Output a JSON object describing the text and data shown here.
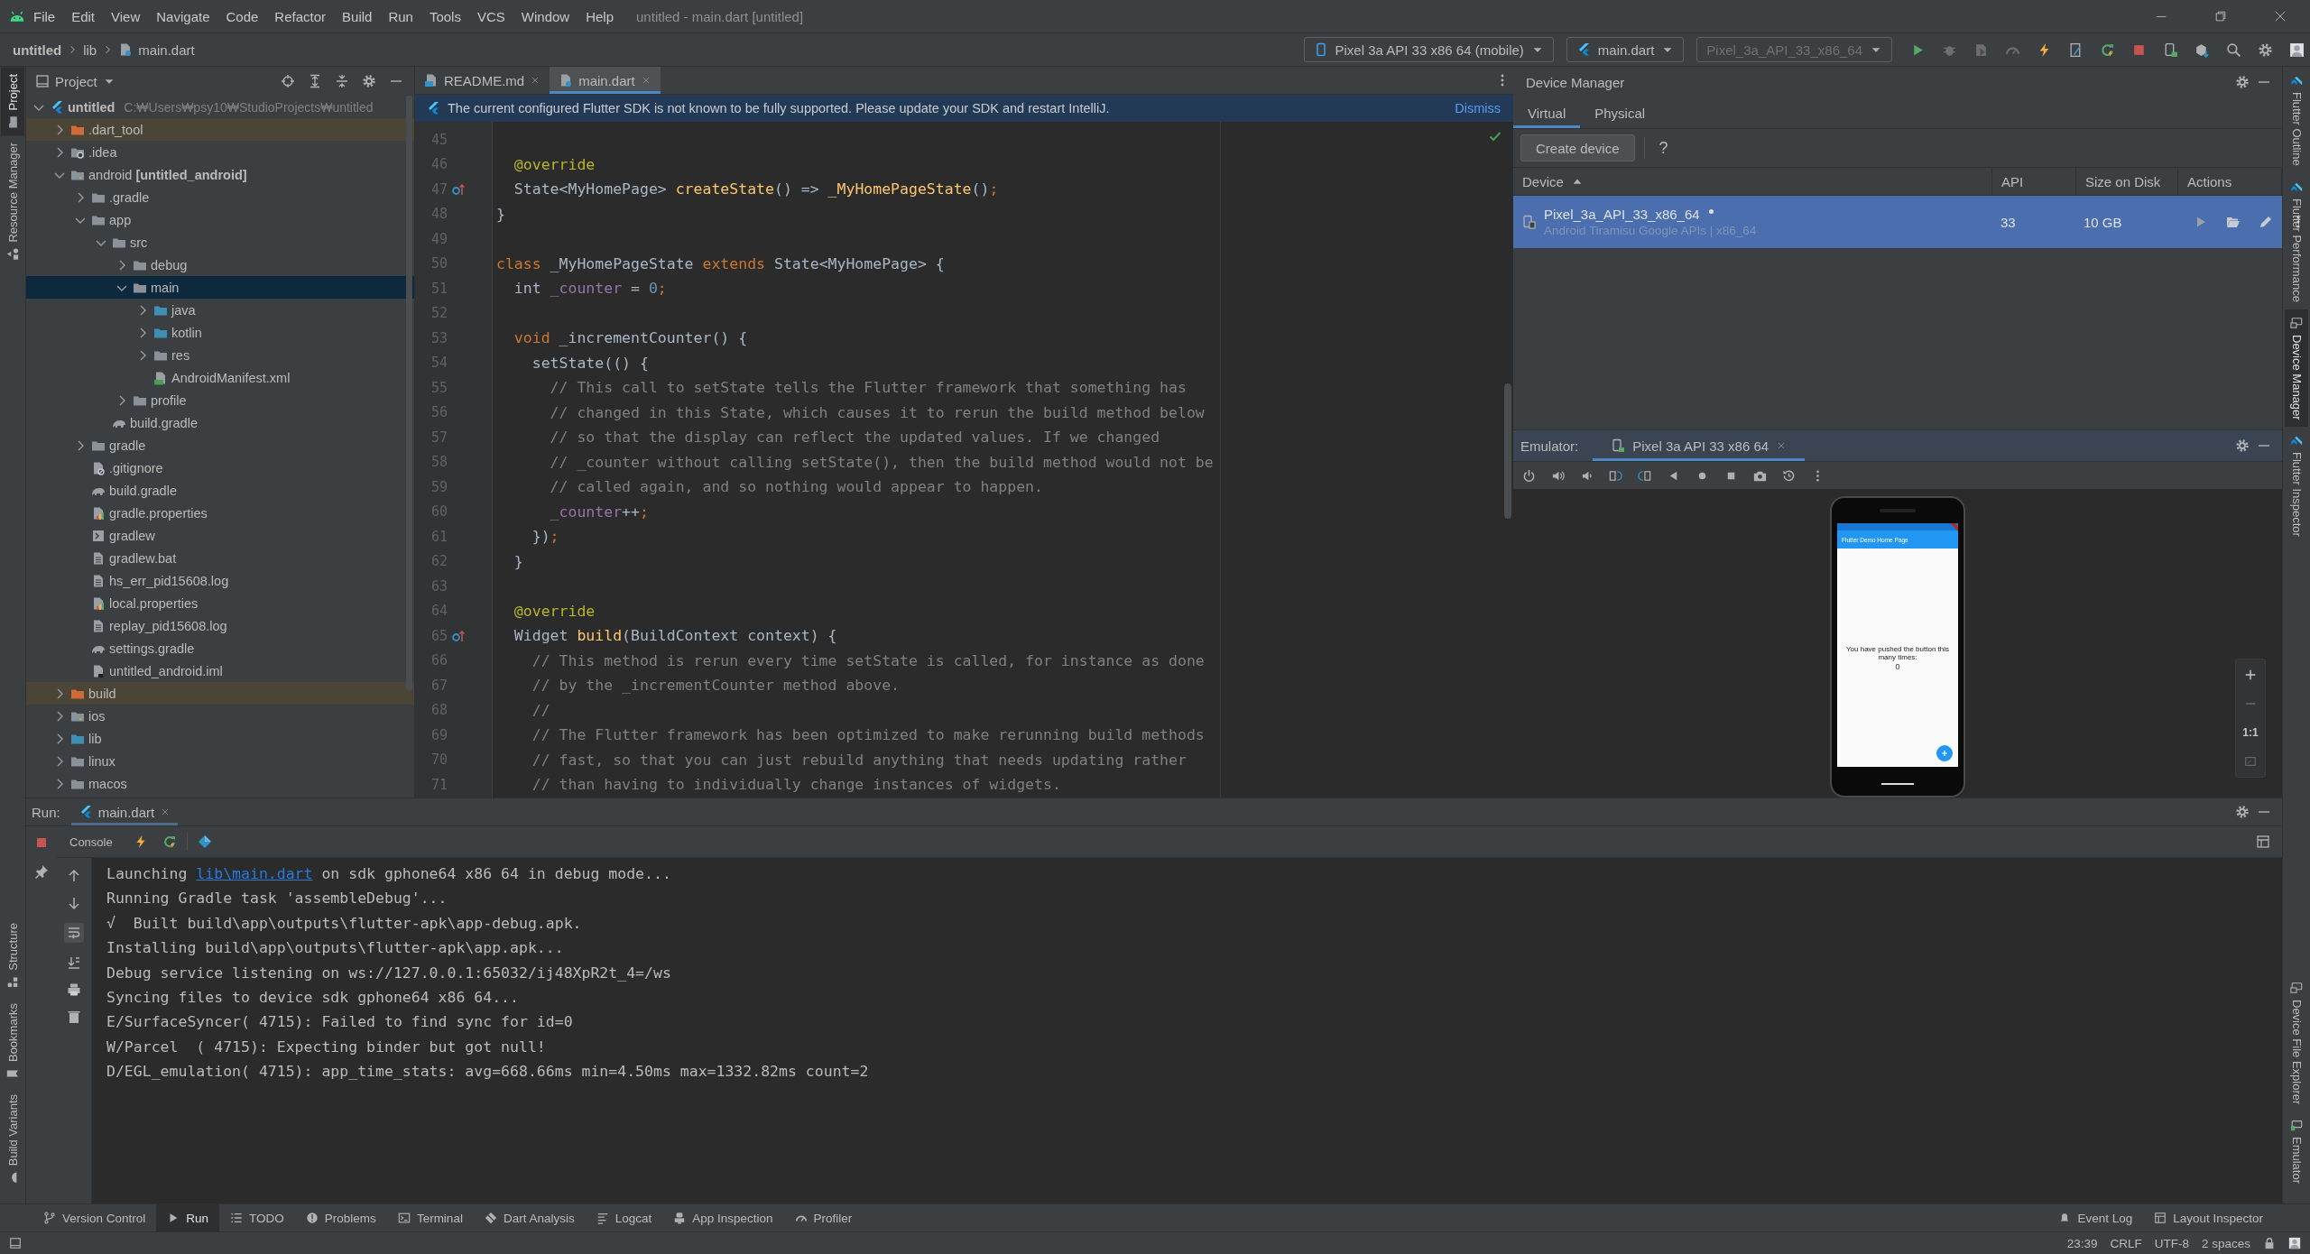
{
  "menu_bar": {
    "items": [
      "File",
      "Edit",
      "View",
      "Navigate",
      "Code",
      "Refactor",
      "Build",
      "Run",
      "Tools",
      "VCS",
      "Window",
      "Help"
    ],
    "title": "untitled - main.dart [untitled]"
  },
  "breadcrumbs": [
    {
      "label": "untitled",
      "kind": "project"
    },
    {
      "label": "lib",
      "kind": "folder"
    },
    {
      "label": "main.dart",
      "kind": "dart"
    }
  ],
  "run_toolbar": {
    "device_selector": "Pixel 3a API 33 x86 64 (mobile)",
    "config_selector": "main.dart",
    "target_selector": {
      "label": "Pixel_3a_API_33_x86_64",
      "disabled": true
    }
  },
  "left_strip": {
    "top": [
      {
        "label": "Project",
        "selected": true
      },
      {
        "label": "Resource Manager",
        "selected": false
      }
    ],
    "bottom": [
      {
        "label": "Structure",
        "selected": false
      },
      {
        "label": "Bookmarks",
        "selected": false
      },
      {
        "label": "Build Variants",
        "selected": false
      }
    ]
  },
  "right_strip": {
    "top": [
      {
        "label": "Flutter Outline",
        "selected": false
      },
      {
        "label": "Flutter Performance",
        "selected": false
      },
      {
        "label": "Device Manager",
        "selected": true
      },
      {
        "label": "Flutter Inspector",
        "selected": false
      }
    ],
    "bottom": [
      {
        "label": "Device File Explorer",
        "selected": false
      },
      {
        "label": "Emulator",
        "selected": false
      }
    ]
  },
  "project_panel": {
    "title": "Project",
    "tree": [
      {
        "label": "untitled",
        "kind": "project",
        "path": "C:₩Users₩psy10₩StudioProjects₩untitled",
        "selected": false,
        "children": [
          {
            "label": ".dart_tool",
            "kind": "excluded",
            "selected": false
          },
          {
            "label": ".idea",
            "kind": "idea",
            "selected": false
          },
          {
            "label": "android **[untitled_android]**",
            "kind": "module",
            "selected": false,
            "children": [
              {
                "label": ".gradle",
                "kind": "folder",
                "selected": false
              },
              {
                "label": "app",
                "kind": "folder",
                "selected": false,
                "children": [
                  {
                    "label": "src",
                    "kind": "folder",
                    "selected": false,
                    "children": [
                      {
                        "label": "debug",
                        "kind": "folder",
                        "selected": false
                      },
                      {
                        "label": "main",
                        "kind": "folder",
                        "selected": true,
                        "children": [
                          {
                            "label": "java",
                            "kind": "source",
                            "selected": false
                          },
                          {
                            "label": "kotlin",
                            "kind": "source",
                            "selected": false
                          },
                          {
                            "label": "res",
                            "kind": "folder",
                            "selected": false
                          },
                          {
                            "label": "AndroidManifest.xml",
                            "kind": "manifest",
                            "selected": false
                          }
                        ]
                      },
                      {
                        "label": "profile",
                        "kind": "folder",
                        "selected": false
                      }
                    ]
                  },
                  {
                    "label": "build.gradle",
                    "kind": "gradle",
                    "selected": false
                  }
                ]
              },
              {
                "label": "gradle",
                "kind": "folder",
                "selected": false
              },
              {
                "label": ".gitignore",
                "kind": "ignore",
                "selected": false
              },
              {
                "label": "build.gradle",
                "kind": "gradle",
                "selected": false
              },
              {
                "label": "gradle.properties",
                "kind": "properties",
                "selected": false
              },
              {
                "label": "gradlew",
                "kind": "script",
                "selected": false
              },
              {
                "label": "gradlew.bat",
                "kind": "text",
                "selected": false
              },
              {
                "label": "hs_err_pid15608.log",
                "kind": "text",
                "selected": false
              },
              {
                "label": "local.properties",
                "kind": "properties",
                "selected": false
              },
              {
                "label": "replay_pid15608.log",
                "kind": "text",
                "selected": false
              },
              {
                "label": "settings.gradle",
                "kind": "gradle",
                "selected": false
              },
              {
                "label": "untitled_android.iml",
                "kind": "iml",
                "selected": false
              }
            ]
          },
          {
            "label": "build",
            "kind": "excluded",
            "selected": false
          },
          {
            "label": "ios",
            "kind": "module",
            "selected": false
          },
          {
            "label": "lib",
            "kind": "source",
            "selected": false
          },
          {
            "label": "linux",
            "kind": "folder",
            "selected": false
          },
          {
            "label": "macos",
            "kind": "folder",
            "selected": false
          }
        ]
      }
    ]
  },
  "editor": {
    "tabs": [
      {
        "label": "README.md",
        "kind": "markdown",
        "selected": false
      },
      {
        "label": "main.dart",
        "kind": "dart",
        "selected": true
      }
    ],
    "banner": {
      "message": "The current configured Flutter SDK is not known to be fully supported. Please update your SDK and restart IntelliJ.",
      "action": "Dismiss"
    },
    "lines": [
      {
        "number": "45",
        "override": false
      },
      {
        "number": "46",
        "override": false,
        "tokens": [
          {
            "text": "  @override",
            "kind": "annotation"
          }
        ]
      },
      {
        "number": "47",
        "override": true,
        "tokens": [
          {
            "text": "  State<MyHomePage> ",
            "kind": "plain"
          },
          {
            "text": "createState",
            "kind": "function"
          },
          {
            "text": "() => ",
            "kind": "plain"
          },
          {
            "text": "_MyHomePageState",
            "kind": "function"
          },
          {
            "text": "()",
            "kind": "plain"
          },
          {
            "text": ";",
            "kind": "keyword"
          }
        ]
      },
      {
        "number": "48",
        "override": false,
        "tokens": [
          {
            "text": "}",
            "kind": "plain"
          }
        ]
      },
      {
        "number": "49",
        "override": false
      },
      {
        "number": "50",
        "override": false,
        "tokens": [
          {
            "text": "class",
            "kind": "keyword"
          },
          {
            "text": " _MyHomePageState ",
            "kind": "plain"
          },
          {
            "text": "extends",
            "kind": "keyword"
          },
          {
            "text": " State<MyHomePage> {",
            "kind": "plain"
          }
        ]
      },
      {
        "number": "51",
        "override": false,
        "tokens": [
          {
            "text": "  int ",
            "kind": "plain"
          },
          {
            "text": "_counter",
            "kind": "field"
          },
          {
            "text": " = ",
            "kind": "plain"
          },
          {
            "text": "0",
            "kind": "number"
          },
          {
            "text": ";",
            "kind": "keyword"
          }
        ]
      },
      {
        "number": "52",
        "override": false
      },
      {
        "number": "53",
        "override": false,
        "tokens": [
          {
            "text": "  void",
            "kind": "keyword"
          },
          {
            "text": " _incrementCounter() {",
            "kind": "plain"
          }
        ]
      },
      {
        "number": "54",
        "override": false,
        "tokens": [
          {
            "text": "    setState(() {",
            "kind": "plain"
          }
        ]
      },
      {
        "number": "55",
        "override": false,
        "tokens": [
          {
            "text": "      // This call to setState tells the Flutter framework that something has",
            "kind": "comment"
          }
        ]
      },
      {
        "number": "56",
        "override": false,
        "tokens": [
          {
            "text": "      // changed in this State, which causes it to rerun the build method below",
            "kind": "comment"
          }
        ]
      },
      {
        "number": "57",
        "override": false,
        "tokens": [
          {
            "text": "      // so that the display can reflect the updated values. If we changed",
            "kind": "comment"
          }
        ]
      },
      {
        "number": "58",
        "override": false,
        "tokens": [
          {
            "text": "      // _counter without calling setState(), then the build method would not be",
            "kind": "comment"
          }
        ]
      },
      {
        "number": "59",
        "override": false,
        "tokens": [
          {
            "text": "      // called again, and so nothing would appear to happen.",
            "kind": "comment"
          }
        ]
      },
      {
        "number": "60",
        "override": false,
        "tokens": [
          {
            "text": "      _counter",
            "kind": "field"
          },
          {
            "text": "++",
            "kind": "plain"
          },
          {
            "text": ";",
            "kind": "keyword"
          }
        ]
      },
      {
        "number": "61",
        "override": false,
        "tokens": [
          {
            "text": "    })",
            "kind": "plain"
          },
          {
            "text": ";",
            "kind": "keyword"
          }
        ]
      },
      {
        "number": "62",
        "override": false,
        "tokens": [
          {
            "text": "  }",
            "kind": "plain"
          }
        ]
      },
      {
        "number": "63",
        "override": false
      },
      {
        "number": "64",
        "override": false,
        "tokens": [
          {
            "text": "  @override",
            "kind": "annotation"
          }
        ]
      },
      {
        "number": "65",
        "override": true,
        "tokens": [
          {
            "text": "  Widget ",
            "kind": "plain"
          },
          {
            "text": "build",
            "kind": "function"
          },
          {
            "text": "(BuildContext context) {",
            "kind": "plain"
          }
        ]
      },
      {
        "number": "66",
        "override": false,
        "tokens": [
          {
            "text": "    // This method is rerun every time setState is called, for instance as done",
            "kind": "comment"
          }
        ]
      },
      {
        "number": "67",
        "override": false,
        "tokens": [
          {
            "text": "    // by the _incrementCounter method above.",
            "kind": "comment"
          }
        ]
      },
      {
        "number": "68",
        "override": false,
        "tokens": [
          {
            "text": "    //",
            "kind": "comment"
          }
        ]
      },
      {
        "number": "69",
        "override": false,
        "tokens": [
          {
            "text": "    // The Flutter framework has been optimized to make rerunning build methods",
            "kind": "comment"
          }
        ]
      },
      {
        "number": "70",
        "override": false,
        "tokens": [
          {
            "text": "    // fast, so that you can just rebuild anything that needs updating rather",
            "kind": "comment"
          }
        ]
      },
      {
        "number": "71",
        "override": false,
        "tokens": [
          {
            "text": "    // than having to individually change instances of widgets.",
            "kind": "comment"
          }
        ]
      }
    ]
  },
  "device_manager": {
    "title": "Device Manager",
    "tabs": [
      {
        "label": "Virtual",
        "selected": true
      },
      {
        "label": "Physical",
        "selected": false
      }
    ],
    "create_button": "Create device",
    "help": "?",
    "columns": [
      {
        "label": "Device",
        "sorted": true
      },
      {
        "label": "API",
        "sorted": false
      },
      {
        "label": "Size on Disk",
        "sorted": false
      },
      {
        "label": "Actions",
        "sorted": false
      }
    ],
    "devices": [
      {
        "name": "Pixel_3a_API_33_x86_64",
        "running": true,
        "details": "Android Tiramisu Google APIs | x86_64",
        "api": "33",
        "size": "10 GB",
        "selected": true
      }
    ]
  },
  "emulator": {
    "label": "Emulator:",
    "tab": "Pixel 3a API 33 x86 64",
    "screen": {
      "app_title": "Flutter Demo Home Page",
      "message": "You have pushed the button this many times:",
      "counter": "0"
    },
    "actual_size": "1:1"
  },
  "run_panel": {
    "label": "Run:",
    "tab": "main.dart",
    "console_tab": "Console",
    "lines": [
      {
        "tokens": [
          {
            "text": "Launching ",
            "kind": "plain"
          },
          {
            "text": "lib\\main.dart",
            "kind": "link"
          },
          {
            "text": " on sdk gphone64 x86 64 in debug mode...",
            "kind": "plain"
          }
        ]
      },
      {
        "tokens": [
          {
            "text": "Running Gradle task 'assembleDebug'...",
            "kind": "plain"
          }
        ]
      },
      {
        "tokens": [
          {
            "text": "√  Built build\\app\\outputs\\flutter-apk\\app-debug.apk.",
            "kind": "plain"
          }
        ]
      },
      {
        "tokens": [
          {
            "text": "Installing build\\app\\outputs\\flutter-apk\\app.apk...",
            "kind": "plain"
          }
        ]
      },
      {
        "tokens": [
          {
            "text": "Debug service listening on ws://127.0.0.1:65032/ij48XpR2t_4=/ws",
            "kind": "plain"
          }
        ]
      },
      {
        "tokens": [
          {
            "text": "Syncing files to device sdk gphone64 x86 64...",
            "kind": "plain"
          }
        ]
      },
      {
        "tokens": [
          {
            "text": "E/SurfaceSyncer( 4715): Failed to find sync for id=0",
            "kind": "plain"
          }
        ]
      },
      {
        "tokens": [
          {
            "text": "W/Parcel  ( 4715): Expecting binder but got null!",
            "kind": "plain"
          }
        ]
      },
      {
        "tokens": [
          {
            "text": "D/EGL_emulation( 4715): app_time_stats: avg=668.66ms min=4.50ms max=1332.82ms count=2",
            "kind": "plain"
          }
        ]
      }
    ]
  },
  "bottom_bar": {
    "tools": [
      {
        "label": "Version Control",
        "kind": "vcs",
        "selected": false
      },
      {
        "label": "Run",
        "kind": "run",
        "selected": true
      },
      {
        "label": "TODO",
        "kind": "todo",
        "selected": false
      },
      {
        "label": "Problems",
        "kind": "problems",
        "selected": false
      },
      {
        "label": "Terminal",
        "kind": "terminal",
        "selected": false
      },
      {
        "label": "Dart Analysis",
        "kind": "dart",
        "selected": false
      },
      {
        "label": "Logcat",
        "kind": "logcat",
        "selected": false
      },
      {
        "label": "App Inspection",
        "kind": "inspection",
        "selected": false
      },
      {
        "label": "Profiler",
        "kind": "profiler",
        "selected": false
      }
    ],
    "right_tools": [
      {
        "label": "Event Log",
        "kind": "event",
        "selected": false
      },
      {
        "label": "Layout Inspector",
        "kind": "layout",
        "selected": false
      }
    ]
  },
  "status_bar": {
    "items": [
      "23:39",
      "CRLF",
      "UTF-8",
      "2 spaces"
    ]
  }
}
